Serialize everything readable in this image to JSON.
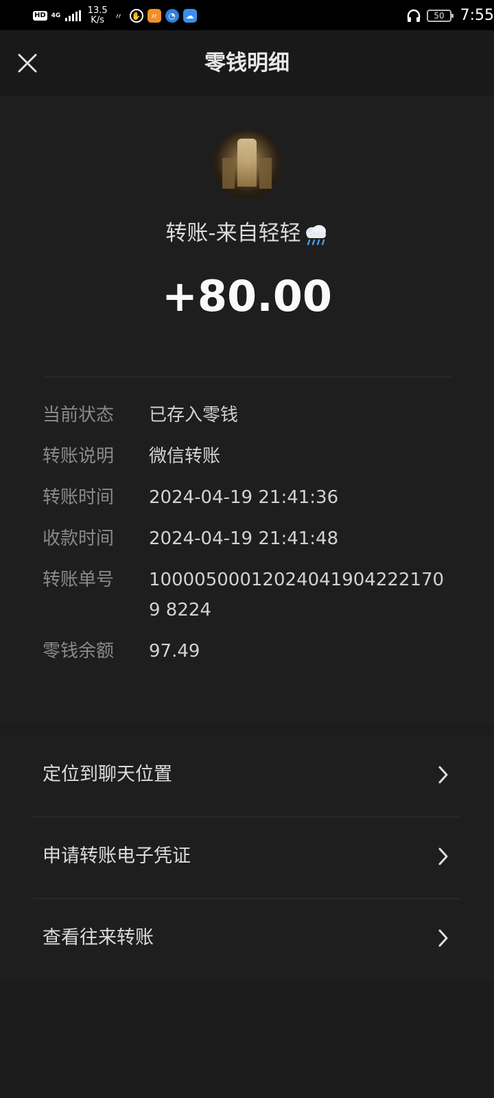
{
  "status_bar": {
    "hd": "HD",
    "network": "4G",
    "speed_value": "13.5",
    "speed_unit": "K/s",
    "battery": "50",
    "time": "7:55"
  },
  "header": {
    "title": "零钱明细"
  },
  "transfer": {
    "counterparty": "转账-来自轻轻",
    "amount": "+80.00"
  },
  "details": [
    {
      "label": "当前状态",
      "value": "已存入零钱"
    },
    {
      "label": "转账说明",
      "value": "微信转账"
    },
    {
      "label": "转账时间",
      "value": "2024-04-19 21:41:36"
    },
    {
      "label": "收款时间",
      "value": "2024-04-19 21:41:48"
    },
    {
      "label": "转账单号",
      "value": "100005000120240419042221709 8224"
    },
    {
      "label": "零钱余额",
      "value": "97.49"
    }
  ],
  "actions": [
    {
      "label": "定位到聊天位置"
    },
    {
      "label": "申请转账电子凭证"
    },
    {
      "label": "查看往来转账"
    }
  ],
  "colors": {
    "background": "#1c1c1c",
    "card": "#1e1e1e",
    "label_gray": "#8a8a8a"
  }
}
